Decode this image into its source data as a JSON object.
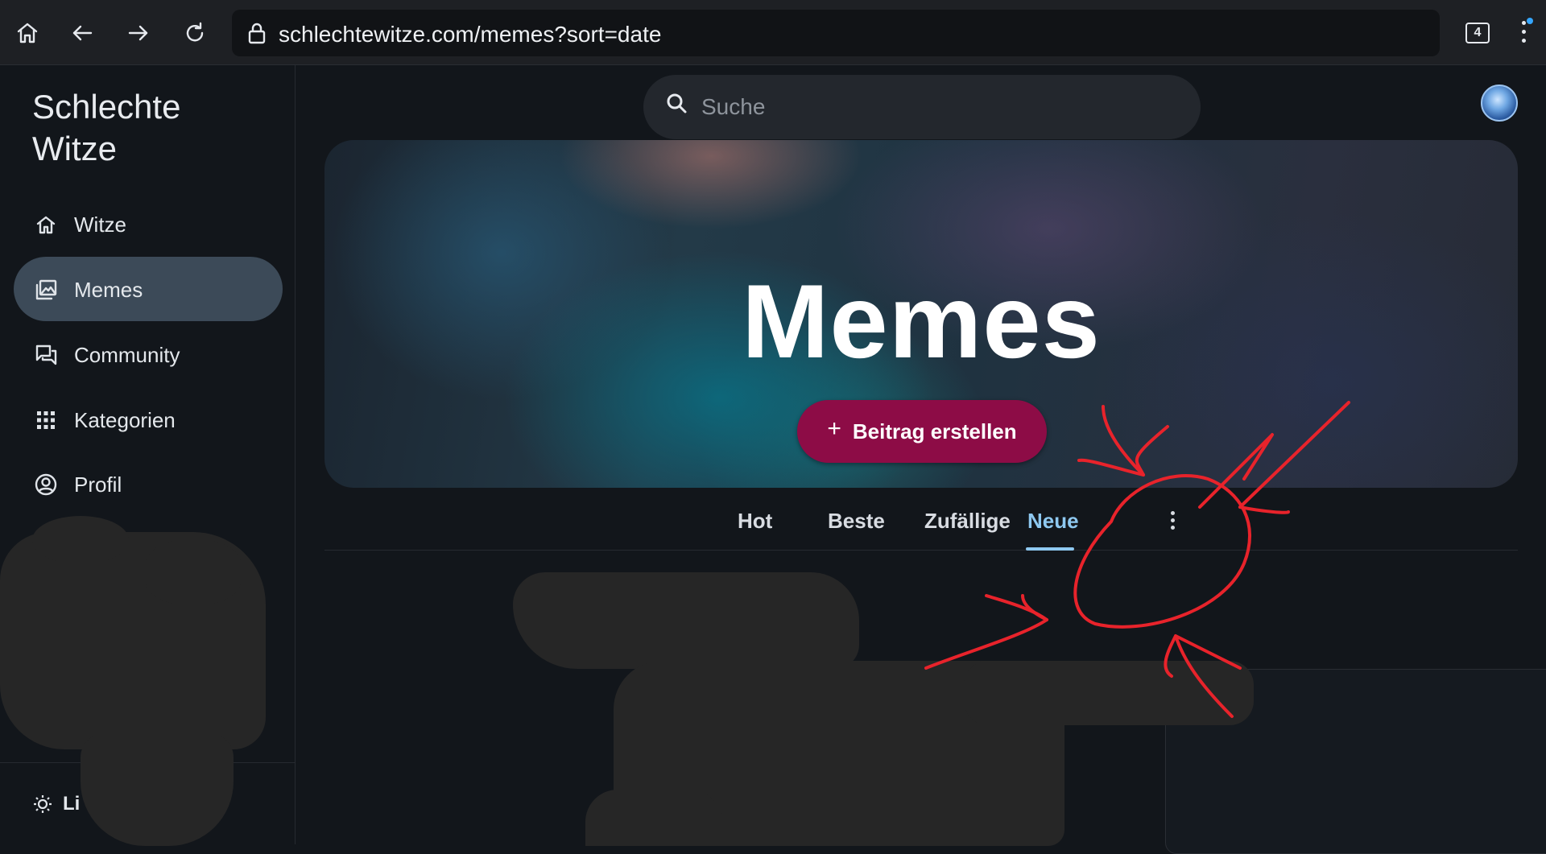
{
  "browser": {
    "url": "schlechtewitze.com/memes?sort=date",
    "tab_count": "4"
  },
  "sidebar": {
    "site_title_line1": "Schlechte",
    "site_title_line2": "Witze",
    "items": [
      {
        "label": "Witze",
        "icon": "home-icon"
      },
      {
        "label": "Memes",
        "icon": "image-gallery-icon",
        "active": true
      },
      {
        "label": "Community",
        "icon": "forum-icon"
      },
      {
        "label": "Kategorien",
        "icon": "grid-icon"
      },
      {
        "label": "Profil",
        "icon": "account-circle-icon"
      }
    ],
    "theme_toggle_label": "Li"
  },
  "search": {
    "placeholder": "Suche"
  },
  "hero": {
    "title": "Memes",
    "create_button_label": "Beitrag erstellen"
  },
  "tabs": [
    {
      "label": "Hot"
    },
    {
      "label": "Beste"
    },
    {
      "label": "Zufällige"
    },
    {
      "label": "Neue",
      "active": true
    }
  ],
  "colors": {
    "accent": "#8ec8f0",
    "create_button": "#8d0c46",
    "active_nav": "#3c4a58",
    "annotation": "#e8232b"
  }
}
